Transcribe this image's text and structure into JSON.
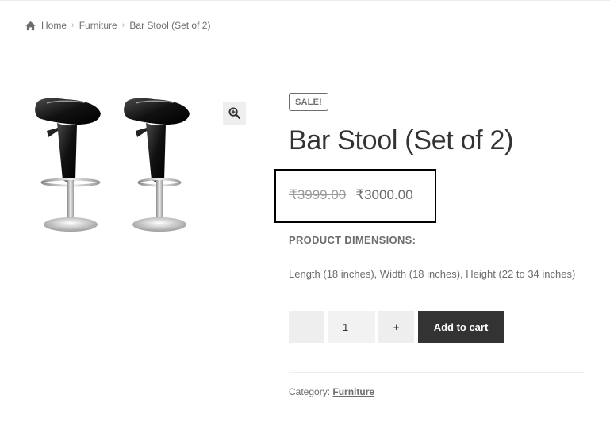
{
  "breadcrumb": {
    "home_icon": "home-icon",
    "items": [
      "Home",
      "Furniture",
      "Bar Stool (Set of 2)"
    ]
  },
  "gallery": {
    "image_alt": "Two black bar stools",
    "zoom_icon": "magnifier-plus-icon"
  },
  "product": {
    "badge": "SALE!",
    "title": "Bar Stool (Set of 2)",
    "price_old": "₹3999.00",
    "price_new": "₹3000.00",
    "dimensions_heading": "PRODUCT DIMENSIONS:",
    "dimensions_text": "Length (18 inches), Width (18 inches), Height (22 to 34 inches)"
  },
  "cart": {
    "minus_label": "-",
    "quantity": "1",
    "plus_label": "+",
    "add_label": "Add to cart"
  },
  "meta": {
    "category_label": "Category:",
    "category_value": "Furniture"
  },
  "colors": {
    "text": "#6d6d6d",
    "title": "#333333",
    "button_dark": "#333333",
    "button_light": "#eeeeee",
    "highlight_border": "#000000"
  }
}
